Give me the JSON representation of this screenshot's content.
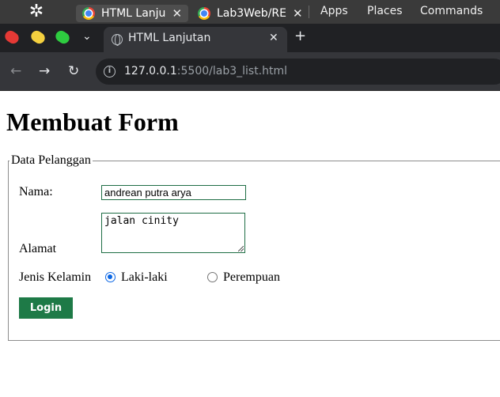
{
  "os_panel": {
    "tabs": [
      {
        "label": "HTML Lanju"
      },
      {
        "label": "Lab3Web/RE"
      }
    ],
    "menu": [
      "Apps",
      "Places",
      "Commands"
    ]
  },
  "browser": {
    "tab_title": "HTML Lanjutan",
    "new_tab": "+",
    "url_host": "127.0.0.1",
    "url_rest": ":5500/lab3_list.html"
  },
  "page": {
    "heading": "Membuat Form",
    "legend": "Data Pelanggan",
    "nama_label": "Nama:",
    "nama_value": "andrean putra arya",
    "alamat_label": "Alamat",
    "alamat_value": "jalan cinity",
    "gender_label": "Jenis Kelamin",
    "gender_options": [
      {
        "label": "Laki-laki",
        "checked": true
      },
      {
        "label": "Perempuan",
        "checked": false
      }
    ],
    "login_label": "Login"
  },
  "colors": {
    "os_panel": "#3a3a3a",
    "tabstrip": "#202124",
    "toolbar": "#35363a",
    "button": "#1e7a47",
    "radio_checked": "#0b66e4"
  }
}
